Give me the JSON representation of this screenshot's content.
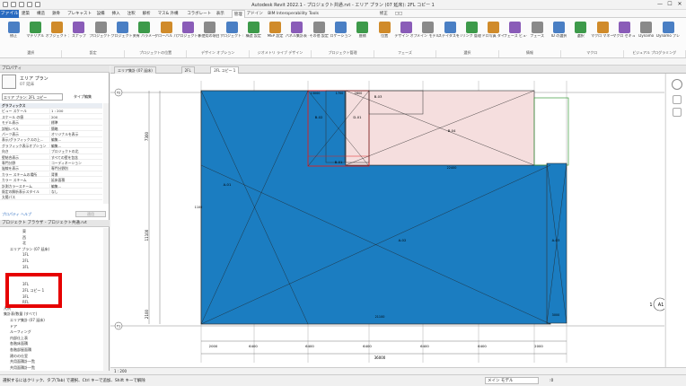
{
  "window": {
    "title": "Autodesk Revit 2022.1 - プロジェクト共通.rvt - エリア プラン (07 延床): 2FL コピー 1",
    "min": "—",
    "max": "☐",
    "close": "✕"
  },
  "menu": {
    "file": "ファイル",
    "tabs": [
      "建築",
      "構造",
      "鉄骨",
      "プレキャスト",
      "設備",
      "挿入",
      "注釈",
      "解析",
      "マス& 外構",
      "コラボレート",
      "表示",
      "管理",
      "アドイン",
      "BIM Interoperability Tools",
      "修正",
      "□□"
    ],
    "active_index": 11
  },
  "ribbon": {
    "buttons": [
      "修正",
      "マテリアル",
      "オブジェクト スタイル",
      "スナップ",
      "プロジェクト 情報",
      "プロジェクト パラメータ",
      "共有 パラメータ",
      "グローバル パラメータ",
      "プロジェクト標準を 転送",
      "未使用の項目 を削除",
      "プロジェクト 単位",
      "構造 設定",
      "MEP 設定",
      "パネル集計表 テンプレート",
      "その他 設定",
      "ロケーション",
      "座標",
      "位置",
      "デザイン オプション",
      "メイン モデル",
      "ステイタスを 取得",
      "リンク 管理",
      "ドロ写真 タイプ",
      "フェーズ ビュー",
      "フェーズ",
      "ID の選択",
      "選択",
      "マクロ マネージャー",
      "マクロ セキュリティ",
      "Dynamo",
      "Dynamo プレイヤー"
    ],
    "groups": [
      "選択",
      "設定",
      "プロジェクトの位置",
      "デザイン オプション",
      "ジオメトリ ライブ デザイン",
      "プロジェクト管理",
      "フェーズ",
      "選択",
      "情報",
      "マクロ",
      "ビジュアル プログラミング"
    ],
    "colors": {
      "icon_blue": "#4a7fc4",
      "icon_green": "#3d9a4a",
      "icon_orange": "#d08b2a",
      "icon_purple": "#8a5cb8",
      "icon_grey": "#8a8a8a"
    }
  },
  "properties": {
    "header": "プロパティ",
    "type_name": "エリア プラン",
    "type_sub": "07 延床",
    "selector": "エリア プラン: 2FL コピー",
    "edit_type": "タイプ編集",
    "rows": [
      {
        "k": "グラフィックス",
        "v": "",
        "sec": true
      },
      {
        "k": "ビュー スケール",
        "v": "1 : 200"
      },
      {
        "k": "スケール の値",
        "v": "200"
      },
      {
        "k": "モデル表示",
        "v": "標準"
      },
      {
        "k": "詳細レベル",
        "v": "簡略"
      },
      {
        "k": "パーツ表示",
        "v": "オリジナルを表示"
      },
      {
        "k": "表示/グラフィックスの上...",
        "v": "編集..."
      },
      {
        "k": "グラフィック表示オプション",
        "v": "編集..."
      },
      {
        "k": "向き",
        "v": "プロジェクトの北"
      },
      {
        "k": "壁結合表示",
        "v": "すべての壁を包含"
      },
      {
        "k": "専門分野",
        "v": "コーディネーション"
      },
      {
        "k": "陰線を表示",
        "v": "専門分野別"
      },
      {
        "k": "カラー スキームの場所",
        "v": "背景"
      },
      {
        "k": "カラー スキーム",
        "v": "延床面積"
      },
      {
        "k": "計測カラースキーム",
        "v": "編集..."
      },
      {
        "k": "既定の解析表示スタイル",
        "v": "なし"
      },
      {
        "k": "太陽パス",
        "v": ""
      }
    ],
    "help": "プロパティ ヘルプ",
    "apply": "適用"
  },
  "browser": {
    "header": "プロジェクト ブラウザ - プロジェクト共通.rvt",
    "items": [
      {
        "t": "東",
        "d": 3
      },
      {
        "t": "西",
        "d": 3
      },
      {
        "t": "北",
        "d": 3
      },
      {
        "t": "エリア プラン (07 延床)",
        "d": 1
      },
      {
        "t": "1FL",
        "d": 3
      },
      {
        "t": "2FL",
        "d": 3
      },
      {
        "t": "3FL",
        "d": 3
      },
      {
        "t": "",
        "d": 3
      },
      {
        "t": "",
        "d": 3
      },
      {
        "t": "3FL",
        "d": 3
      },
      {
        "t": "2FL コピー 1",
        "d": 3
      },
      {
        "t": "3FL",
        "d": 3
      },
      {
        "t": "RFL",
        "d": 3
      },
      {
        "t": "凡例",
        "d": 0
      },
      {
        "t": "集計表/数量 (すべて)",
        "d": 0
      },
      {
        "t": "エリア集計 (07 延床)",
        "d": 1
      },
      {
        "t": "ドア",
        "d": 1
      },
      {
        "t": "ルーフィング",
        "d": 1
      },
      {
        "t": "内部仕上表",
        "d": 1
      },
      {
        "t": "各階床面積",
        "d": 1
      },
      {
        "t": "各階部屋面積",
        "d": 1
      },
      {
        "t": "建のの仕室",
        "d": 1
      },
      {
        "t": "共用面積計一覧",
        "d": 1
      },
      {
        "t": "共用面積計一覧",
        "d": 1
      }
    ]
  },
  "doc_tabs": [
    "エリア集計 (07 延床)",
    "2FL",
    "2FL コピー 1"
  ],
  "doc_active": 2,
  "drawing": {
    "grid_bubbles": [
      "Y2",
      "Y1"
    ],
    "section_label": "A1",
    "dims_bottom": [
      "2000",
      "6400",
      "6400",
      "6400",
      "6400",
      "6400",
      "2000"
    ],
    "dim_total": "36000",
    "dims_left": [
      "7300",
      "11100",
      "2100"
    ],
    "room_labels": [
      "B-02",
      "D-01",
      "B-01",
      "A-01",
      "A-02",
      "A-03",
      "B-04",
      "B-03"
    ],
    "small_dims": [
      "13000",
      "1700",
      "2800",
      "22400",
      "21100",
      "3000",
      "1100"
    ],
    "colors": {
      "blue": "#1b7dc1",
      "pink": "#f5dede",
      "red": "#e02020",
      "green": "#3a9a3a",
      "line": "#333333"
    }
  },
  "view_control": {
    "scale": "1 : 200"
  },
  "status": {
    "text": "選択するにはクリック、タブ(Tab) で選択、Ctrl キーで追加、Shift キーで解除",
    "model": "メイン モデル",
    "zero": ":0"
  }
}
